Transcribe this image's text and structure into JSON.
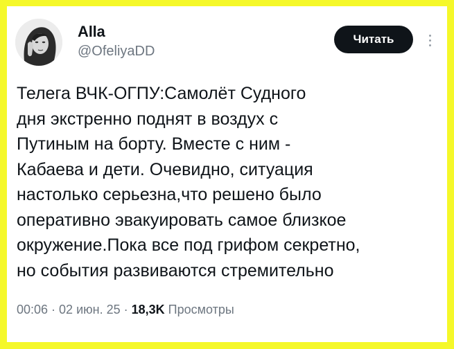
{
  "author": {
    "display_name": "Alla",
    "handle": "@OfeliyaDD",
    "avatar_icon": "avatar-portrait-icon"
  },
  "header": {
    "read_button_label": "Читать",
    "more_icon": "more-vertical-icon"
  },
  "tweet": {
    "lines": [
      "Телега ВЧК-ОГПУ:Самолёт Судного",
      "дня экстренно поднят в воздух с",
      "Путиным на борту. Вместе с ним -",
      "Кабаева и дети. Очевидно, ситуация",
      "настолько серьезна,что решено было",
      "оперативно эвакуировать самое близкое",
      "окружение.Пока все под грифом секретно,",
      "но события развиваются стремительно"
    ]
  },
  "meta": {
    "time": "00:06",
    "separator": "·",
    "date": "02 июн. 25",
    "views_count": "18,3K",
    "views_label": "Просмотры"
  },
  "colors": {
    "frame": "#f5f82a",
    "text": "#0f1419",
    "secondary_text": "#6d7680",
    "button_bg": "#0f1419"
  }
}
